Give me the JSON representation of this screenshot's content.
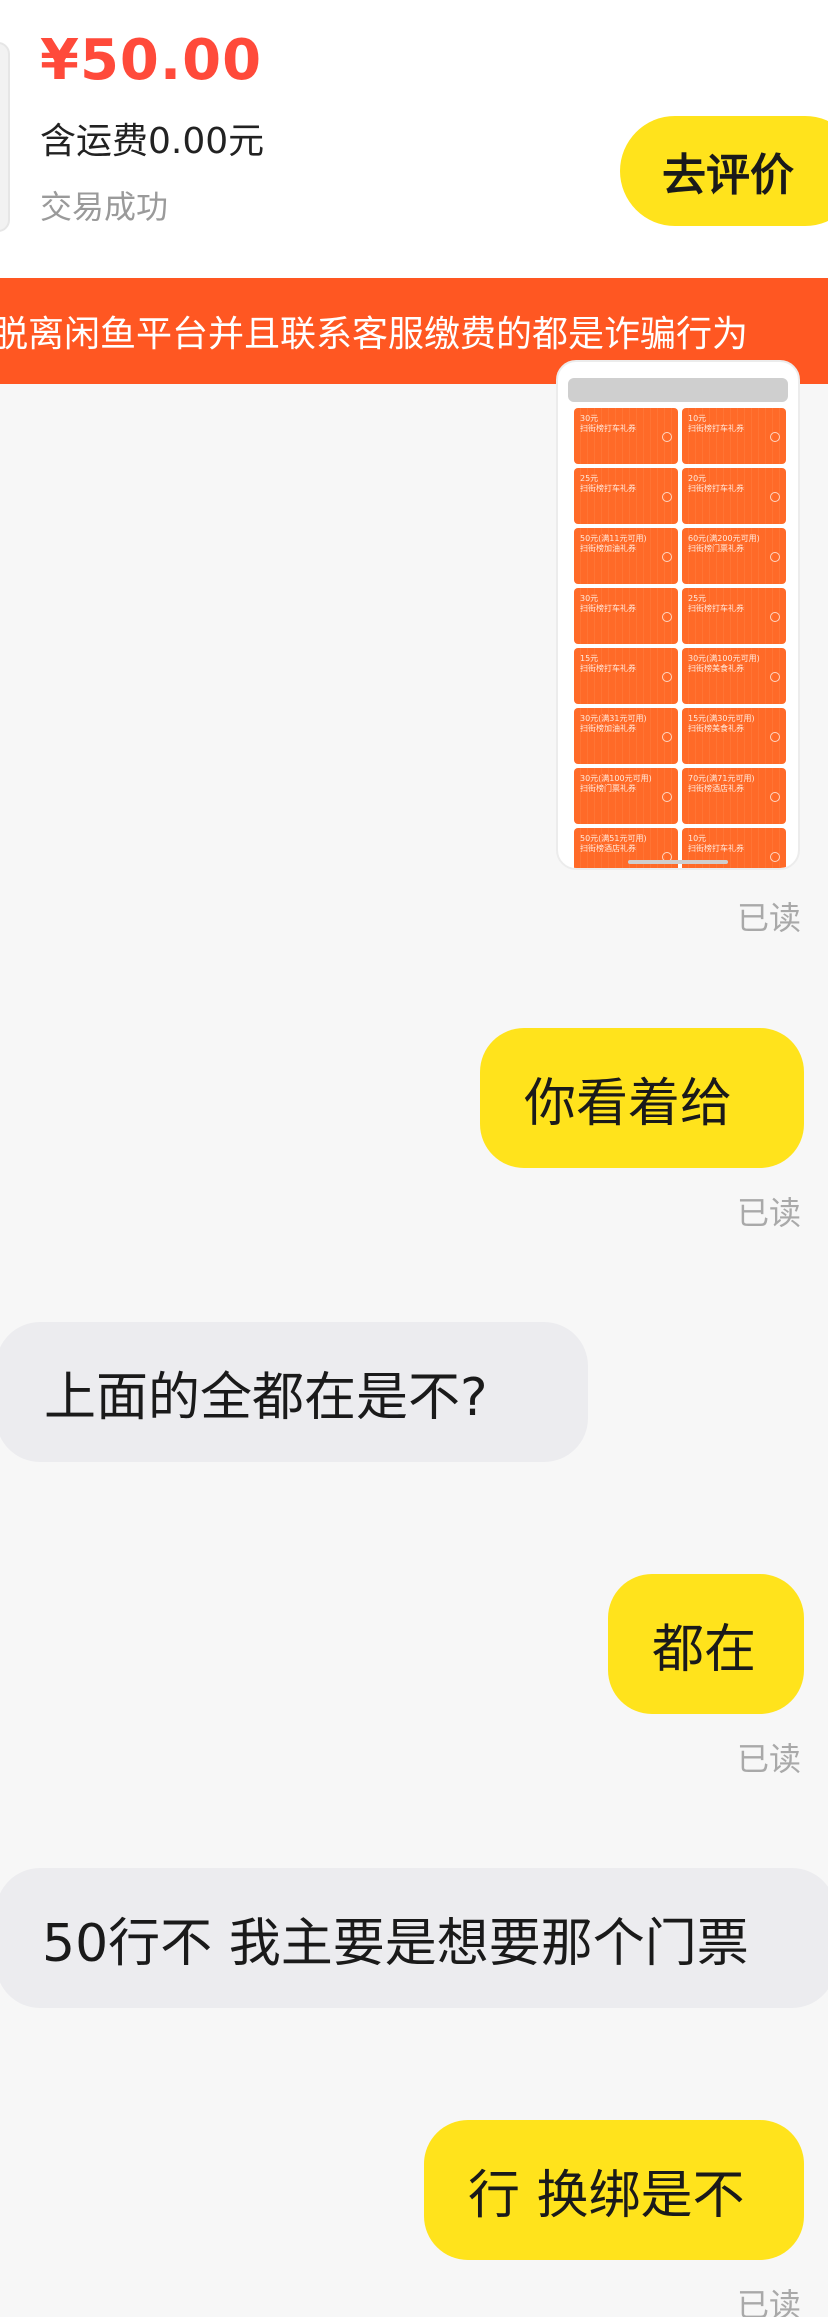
{
  "order": {
    "price": "¥50.00",
    "shipping": "含运费0.00元",
    "status": "交易成功",
    "review_button": "去评价"
  },
  "warning_banner": "脱离闲鱼平台并且联系客服缴费的都是诈骗行为",
  "image_message": {
    "coupons": [
      {
        "amount": "30元",
        "desc": "扫街榜打车礼券"
      },
      {
        "amount": "10元",
        "desc": "扫街榜打车礼券"
      },
      {
        "amount": "25元",
        "desc": "扫街榜打车礼券"
      },
      {
        "amount": "20元",
        "desc": "扫街榜打车礼券"
      },
      {
        "amount": "50元(满11元可用)",
        "desc": "扫街榜加油礼券"
      },
      {
        "amount": "60元(满200元可用)",
        "desc": "扫街榜门票礼券"
      },
      {
        "amount": "30元",
        "desc": "扫街榜打车礼券"
      },
      {
        "amount": "25元",
        "desc": "扫街榜打车礼券"
      },
      {
        "amount": "15元",
        "desc": "扫街榜打车礼券"
      },
      {
        "amount": "30元(满100元可用)",
        "desc": "扫街榜美食礼券"
      },
      {
        "amount": "30元(满31元可用)",
        "desc": "扫街榜加油礼券"
      },
      {
        "amount": "15元(满30元可用)",
        "desc": "扫街榜美食礼券"
      },
      {
        "amount": "30元(满100元可用)",
        "desc": "扫街榜门票礼券"
      },
      {
        "amount": "70元(满71元可用)",
        "desc": "扫街榜酒店礼券"
      },
      {
        "amount": "50元(满51元可用)",
        "desc": "扫街榜酒店礼券"
      },
      {
        "amount": "10元",
        "desc": "扫街榜打车礼券"
      }
    ],
    "read_status": "已读"
  },
  "messages": [
    {
      "sender": "me",
      "text": "你看着给",
      "read_status": "已读"
    },
    {
      "sender": "other",
      "text": "上面的全都在是不?"
    },
    {
      "sender": "me",
      "text": "都在",
      "read_status": "已读"
    },
    {
      "sender": "other",
      "text": "50行不 我主要是想要那个门票"
    },
    {
      "sender": "me",
      "text": "行 换绑是不",
      "read_status": "已读"
    }
  ],
  "colors": {
    "accent_yellow": "#ffe31c",
    "price_red": "#ff4a3a",
    "warning_orange": "#ff5722"
  }
}
